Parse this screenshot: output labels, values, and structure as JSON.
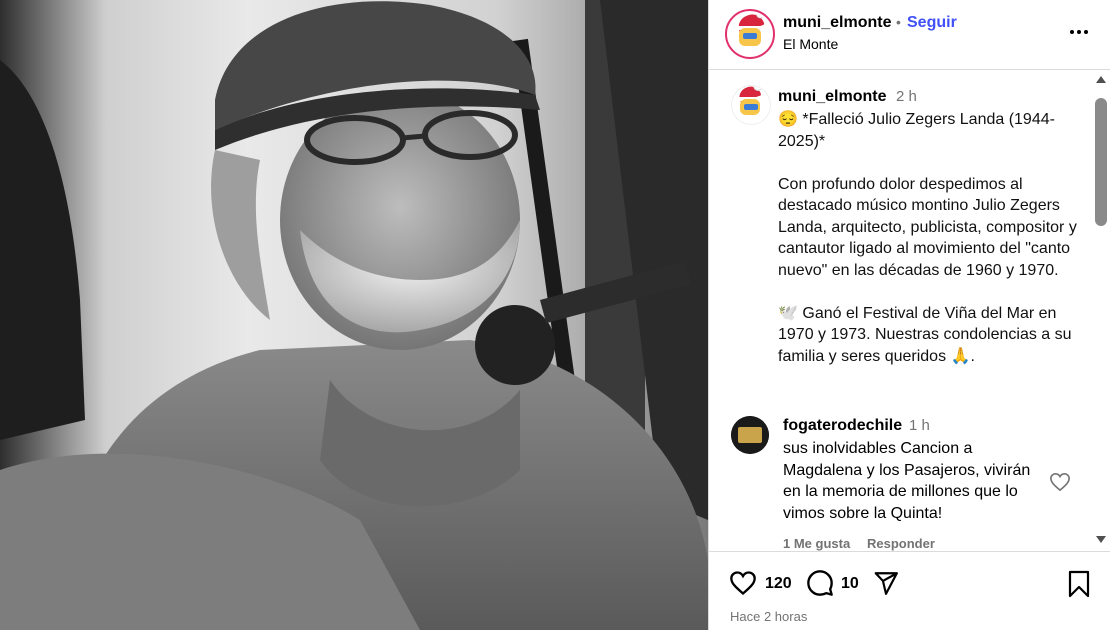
{
  "header": {
    "username": "muni_elmonte",
    "dot": "•",
    "follow_label": "Seguir",
    "location": "El Monte",
    "avatar_icon": "santa-logo-avatar",
    "more_icon": "more-options-icon"
  },
  "caption": {
    "username": "muni_elmonte",
    "time": "2 h",
    "text": "😔 *Falleció Julio Zegers Landa (1944-2025)*\n\nCon profundo dolor despedimos al destacado músico montino Julio Zegers Landa, arquitecto, publicista, compositor y cantautor ligado al movimiento del \"canto nuevo\" en las décadas de 1960 y 1970.\n\n🕊️ Ganó el Festival de Viña del Mar en 1970 y 1973. Nuestras condolencias a su familia y seres queridos 🙏."
  },
  "comment": {
    "username": "fogaterodechile",
    "time": "1 h",
    "text": "sus inolvidables Cancion a Magdalena y los Pasajeros, vivirán en la memoria de millones que lo vimos sobre la Quinta!",
    "likes_label": "1 Me gusta",
    "reply_label": "Responder"
  },
  "actions": {
    "likes_count": "120",
    "comments_count": "10",
    "posted_time": "Hace 2 horas"
  },
  "colors": {
    "follow": "#4150f7",
    "muted": "#737373",
    "border": "#dbdbdb"
  }
}
